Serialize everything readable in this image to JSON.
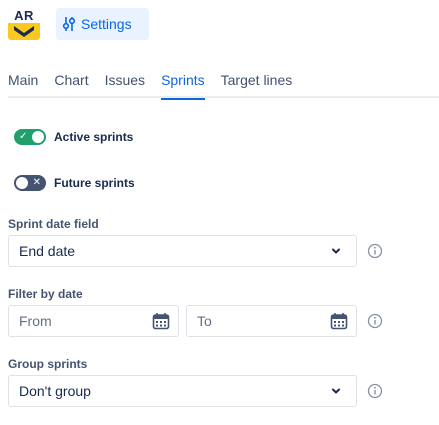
{
  "header": {
    "logo_text": "AR",
    "settings_label": "Settings"
  },
  "tabs": [
    {
      "label": "Main",
      "active": false
    },
    {
      "label": "Chart",
      "active": false
    },
    {
      "label": "Issues",
      "active": false
    },
    {
      "label": "Sprints",
      "active": true
    },
    {
      "label": "Target lines",
      "active": false
    }
  ],
  "toggles": {
    "active_sprints": {
      "label": "Active sprints",
      "on": true
    },
    "future_sprints": {
      "label": "Future sprints",
      "on": false
    }
  },
  "sprint_date_field": {
    "label": "Sprint date field",
    "value": "End date"
  },
  "filter_by_date": {
    "label": "Filter by date",
    "from_placeholder": "From",
    "to_placeholder": "To"
  },
  "group_sprints": {
    "label": "Group sprints",
    "value": "Don't group"
  },
  "colors": {
    "accent": "#0c66e4",
    "toggle_on": "#22a06b",
    "toggle_off": "#44546f",
    "logo_yellow": "#f9c922"
  }
}
